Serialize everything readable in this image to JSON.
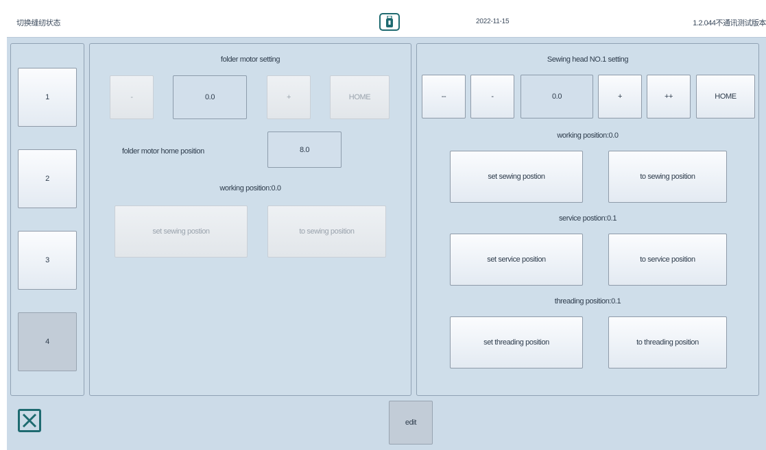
{
  "topbar": {
    "title": "切换缝纫状态",
    "date": "2022-11-15",
    "version": "1.2.044不通讯测试版本",
    "usb_icon": "usb-drive-icon"
  },
  "side_tabs": [
    {
      "label": "1",
      "selected": false
    },
    {
      "label": "2",
      "selected": false
    },
    {
      "label": "3",
      "selected": false
    },
    {
      "label": "4",
      "selected": true
    }
  ],
  "folder": {
    "title": "folder motor setting",
    "minus": "-",
    "value": "0.0",
    "plus": "+",
    "home": "HOME",
    "home_position_label": "folder motor home position",
    "home_position_value": "8.0",
    "working_position": "working position:0.0",
    "set_sewing": "set sewing postion",
    "to_sewing": "to sewing position"
  },
  "sewing_head": {
    "title": "Sewing head NO.1 setting",
    "minus_minus": "--",
    "minus": "-",
    "value": "0.0",
    "plus": "+",
    "plus_plus": "++",
    "home": "HOME",
    "working_position": "working position:0.0",
    "set_sewing": "set sewing postion",
    "to_sewing": "to sewing position",
    "service_position": "service postion:0.1",
    "set_service": "set service position",
    "to_service": "to service position",
    "threading_position": "threading position:0.1",
    "set_threading": "set threading position",
    "to_threading": "to threading  position"
  },
  "bottom": {
    "edit": "edit",
    "close_icon": "close-x-icon"
  },
  "colors": {
    "background": "#ccdbe8",
    "accent": "#1e6a70"
  }
}
